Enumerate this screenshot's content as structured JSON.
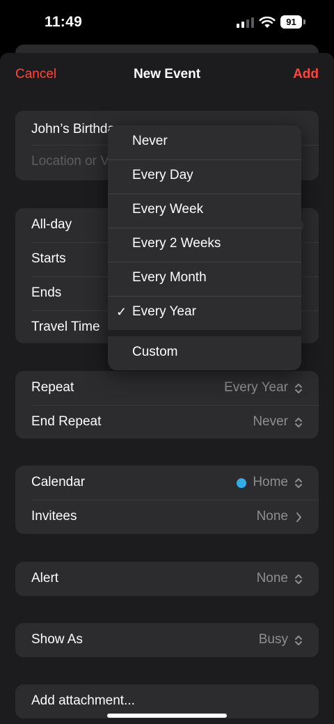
{
  "status_bar": {
    "time": "11:49",
    "battery": "91"
  },
  "nav": {
    "cancel": "Cancel",
    "title": "New Event",
    "add": "Add"
  },
  "details": {
    "title": "John’s Birthda",
    "location_placeholder": "Location or V"
  },
  "timing": {
    "all_day": "All-day",
    "starts": "Starts",
    "ends": "Ends",
    "travel_time": "Travel Time"
  },
  "repeat": {
    "label": "Repeat",
    "value": "Every Year",
    "end_label": "End Repeat",
    "end_value": "Never"
  },
  "calendar": {
    "label": "Calendar",
    "value": "Home",
    "color": "#32ade6",
    "invitees_label": "Invitees",
    "invitees_value": "None"
  },
  "alert": {
    "label": "Alert",
    "value": "None"
  },
  "show_as": {
    "label": "Show As",
    "value": "Busy"
  },
  "attachment": {
    "label": "Add attachment..."
  },
  "repeat_menu": {
    "items": [
      "Never",
      "Every Day",
      "Every Week",
      "Every 2 Weeks",
      "Every Month",
      "Every Year"
    ],
    "selected": "Every Year",
    "custom": "Custom"
  },
  "icons": {
    "chevron": "chevron-up-down-icon",
    "disclosure": "chevron-right-icon",
    "checkmark": "checkmark-icon"
  },
  "colors": {
    "accent": "#ff453a",
    "background": "#1c1c1e",
    "cell": "#2c2c2e"
  }
}
